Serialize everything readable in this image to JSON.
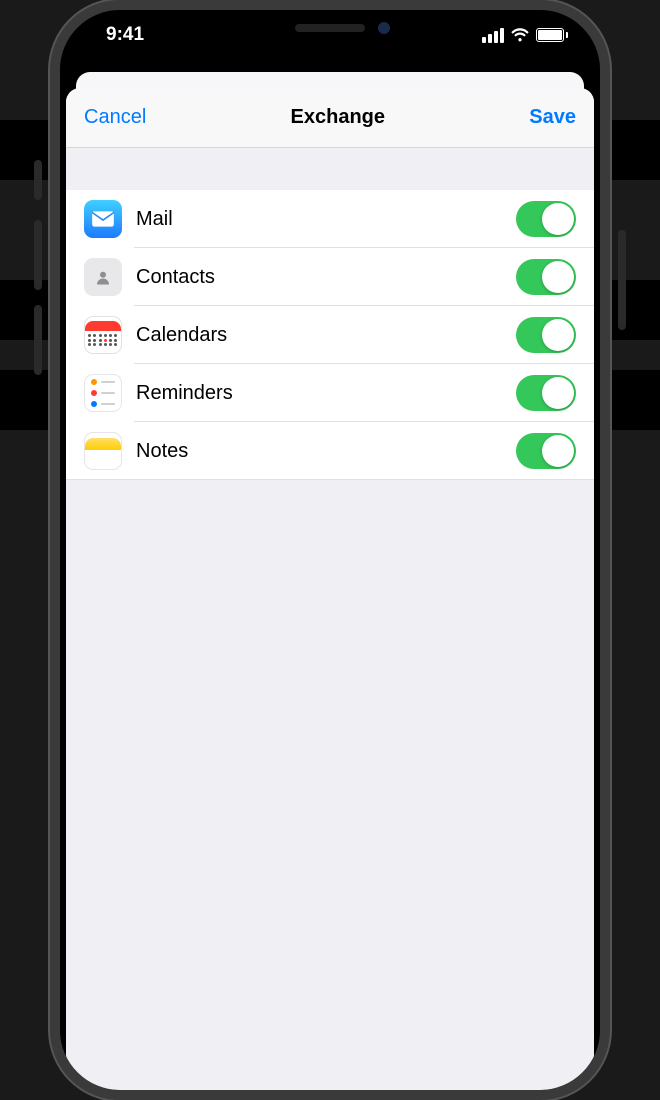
{
  "status": {
    "time": "9:41"
  },
  "nav": {
    "cancel": "Cancel",
    "title": "Exchange",
    "save": "Save"
  },
  "services": [
    {
      "icon": "mail",
      "label": "Mail",
      "on": true
    },
    {
      "icon": "contacts",
      "label": "Contacts",
      "on": true
    },
    {
      "icon": "calendar",
      "label": "Calendars",
      "on": true
    },
    {
      "icon": "reminders",
      "label": "Reminders",
      "on": true
    },
    {
      "icon": "notes",
      "label": "Notes",
      "on": true
    }
  ],
  "colors": {
    "tint": "#007aff",
    "toggle_on": "#34c759"
  }
}
